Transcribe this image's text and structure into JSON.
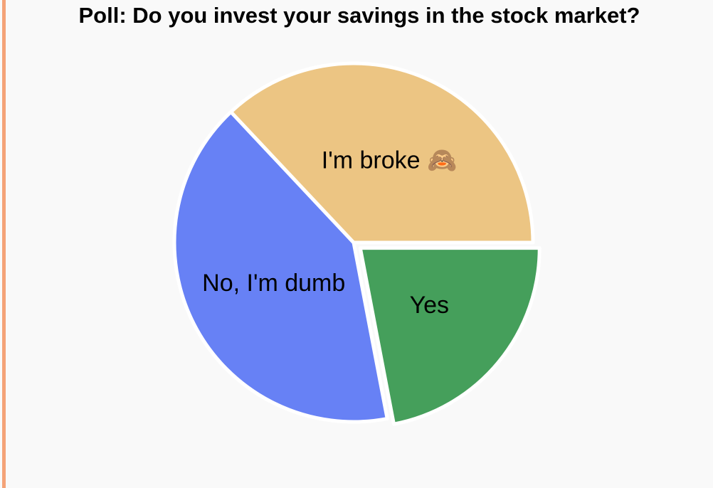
{
  "chart_data": {
    "type": "pie",
    "title": "Poll: Do you invest your savings in the stock market?",
    "slices": [
      {
        "label": "Yes",
        "value": 22,
        "color": "#459f5b",
        "exploded": true
      },
      {
        "label": "No, I'm dumb",
        "value": 41,
        "color": "#6781f5",
        "exploded": false
      },
      {
        "label": "I'm broke 🙈",
        "value": 37,
        "color": "#ecc583",
        "exploded": false
      }
    ],
    "start_direction": "east",
    "direction": "clockwise",
    "slice_border_color": "#ffffff",
    "left_accent_color": "#f4a378",
    "background_color": "#f9f9f9"
  }
}
